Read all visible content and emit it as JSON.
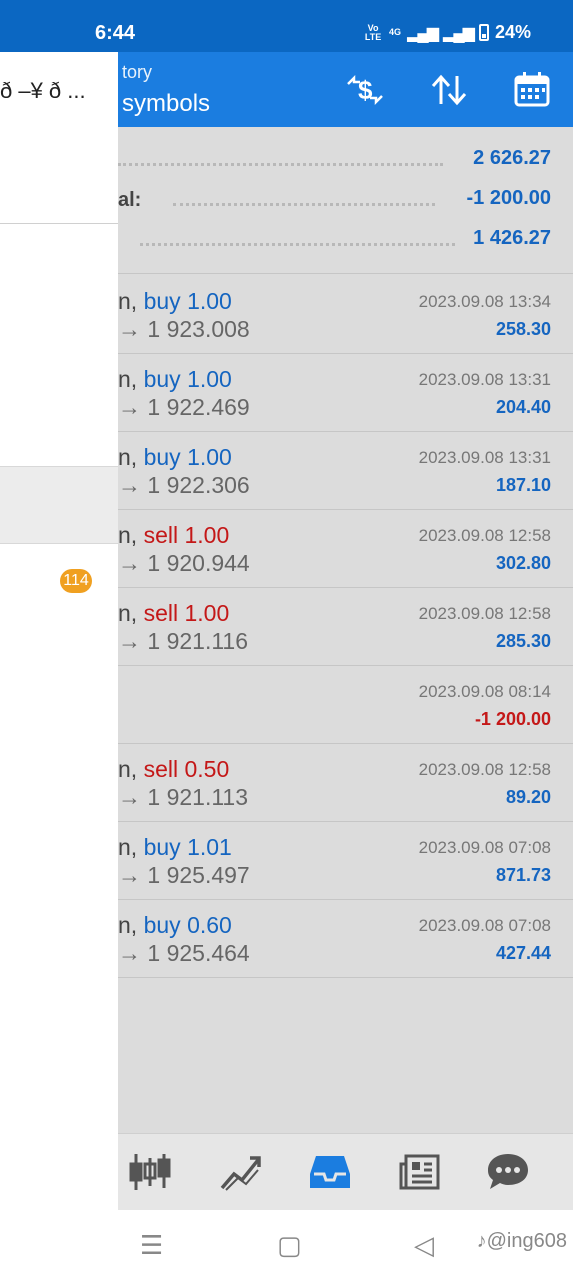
{
  "status_bar": {
    "time": "6:44",
    "volte": "Vo LTE",
    "network": "4G",
    "battery": "24%"
  },
  "app_bar": {
    "subtitle": "tory",
    "title": "symbols",
    "actions": [
      "currency-exchange-icon",
      "sort-icon",
      "calendar-icon"
    ]
  },
  "summary": [
    {
      "label": "",
      "value": "2 626.27"
    },
    {
      "label": "al:",
      "value": "-1 200.00"
    },
    {
      "label": "",
      "value": "1 426.27"
    }
  ],
  "deals": [
    {
      "sym": "n, ",
      "side": "buy",
      "vol": "1.00",
      "price": "→ 1 923.008",
      "time": "2023.09.08 13:34",
      "profit": "258.30"
    },
    {
      "sym": "n, ",
      "side": "buy",
      "vol": "1.00",
      "price": "→ 1 922.469",
      "time": "2023.09.08 13:31",
      "profit": "204.40"
    },
    {
      "sym": "n, ",
      "side": "buy",
      "vol": "1.00",
      "price": "→ 1 922.306",
      "time": "2023.09.08 13:31",
      "profit": "187.10"
    },
    {
      "sym": "n, ",
      "side": "sell",
      "vol": "1.00",
      "price": "→ 1 920.944",
      "time": "2023.09.08 12:58",
      "profit": "302.80"
    },
    {
      "sym": "n, ",
      "side": "sell",
      "vol": "1.00",
      "price": "→ 1 921.116",
      "time": "2023.09.08 12:58",
      "profit": "285.30"
    },
    {
      "sym": "",
      "side": "",
      "vol": "",
      "price": "",
      "time": "2023.09.08 08:14",
      "profit": "-1 200.00"
    },
    {
      "sym": "n, ",
      "side": "sell",
      "vol": "0.50",
      "price": "→ 1 921.113",
      "time": "2023.09.08 12:58",
      "profit": "89.20"
    },
    {
      "sym": "n, ",
      "side": "buy",
      "vol": "1.01",
      "price": "→ 1 925.497",
      "time": "2023.09.08 07:08",
      "profit": "871.73"
    },
    {
      "sym": "n, ",
      "side": "buy",
      "vol": "0.60",
      "price": "→ 1 925.464",
      "time": "2023.09.08 07:08",
      "profit": "427.44"
    }
  ],
  "drawer": {
    "header_text": "ð –¥ ð ...",
    "badge": "114"
  },
  "bottom_nav": [
    "quotes-icon",
    "chart-icon",
    "history-inbox-icon",
    "news-icon",
    "chat-icon"
  ],
  "watermark": "@ing608",
  "colors": {
    "primary": "#1b7de0",
    "status_bar": "#0b67c2",
    "buy": "#1565c0",
    "sell": "#c41818",
    "badge": "#f0a020"
  }
}
